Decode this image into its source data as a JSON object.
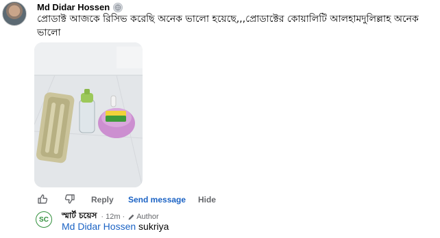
{
  "comment": {
    "author": "Md Didar Hossen",
    "avatar_icon": "user-photo-avatar",
    "badge_icon": "globe-icon",
    "text": "প্রোডাক্ট আজকে রিসিভ করেছি অনেক ভালো হয়েছে,,,প্রোডাক্টের কোয়ালিটি আলহামদুলিল্লাহ অনেক ভালো",
    "photo_icon": "attached-photo"
  },
  "actions": {
    "like_icon": "thumbs-up-icon",
    "dislike_icon": "thumbs-down-icon",
    "reply": "Reply",
    "send_message": "Send message",
    "hide": "Hide"
  },
  "reply": {
    "avatar_text": "SC",
    "name": "স্মার্ট চয়েস",
    "time": "· 12m ·",
    "author_label": "Author",
    "author_icon": "pencil-icon",
    "mention": "Md Didar Hossen",
    "text": " sukriya"
  },
  "colors": {
    "link_blue": "#1a62c4",
    "muted_gray": "#65676b",
    "page_green": "#2f8f3a"
  }
}
